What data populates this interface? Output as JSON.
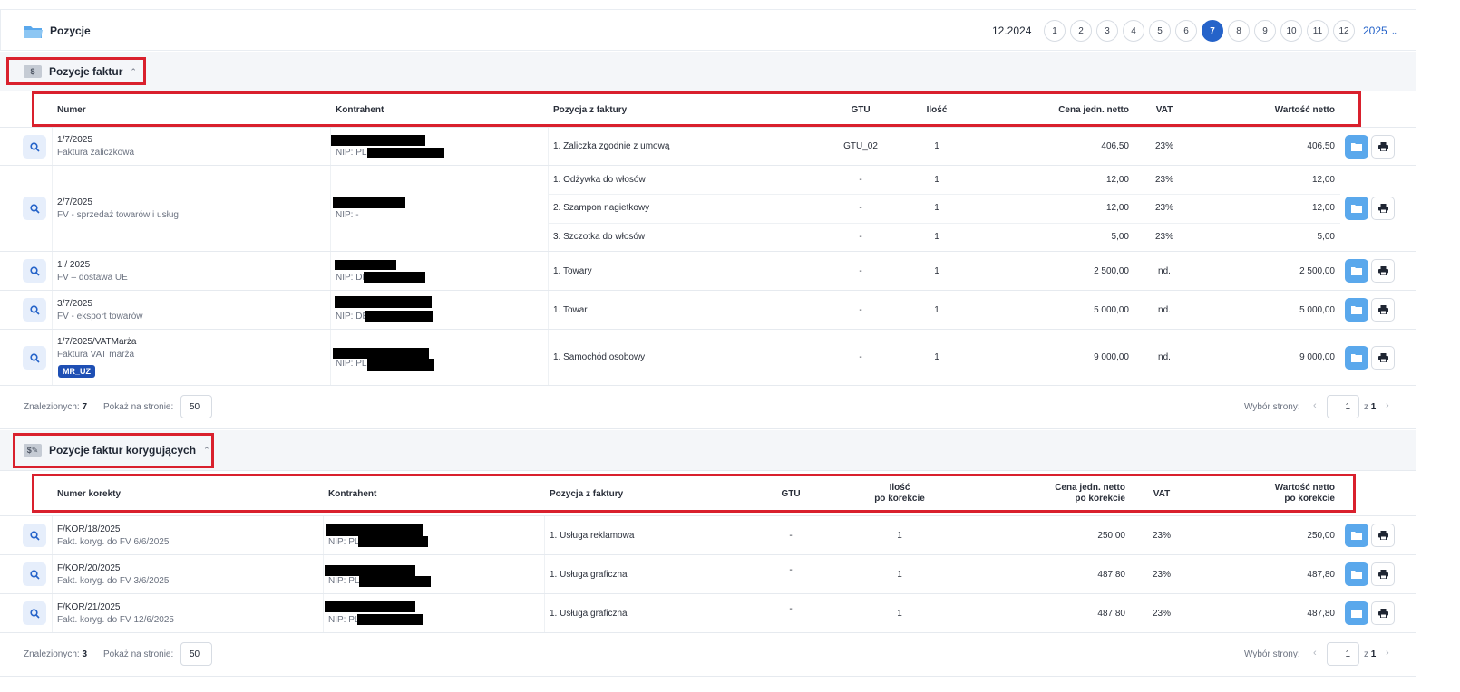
{
  "header": {
    "title": "Pozycje",
    "period": "12.2024",
    "months": [
      "1",
      "2",
      "3",
      "4",
      "5",
      "6",
      "7",
      "8",
      "9",
      "10",
      "11",
      "12"
    ],
    "active_month": "7",
    "year": "2025"
  },
  "invoices": {
    "section_title": "Pozycje faktur",
    "columns": {
      "number": "Numer",
      "contractor": "Kontrahent",
      "item": "Pozycja z faktury",
      "gtu": "GTU",
      "qty": "Ilość",
      "unit_price": "Cena jedn. netto",
      "vat": "VAT",
      "net_value": "Wartość netto"
    },
    "rows": [
      {
        "number": "1/7/2025",
        "type": "Faktura zaliczkowa",
        "nip": "NIP: PL",
        "items": [
          {
            "name": "1. Zaliczka zgodnie z umową",
            "gtu": "GTU_02",
            "qty": "1",
            "price": "406,50",
            "vat": "23%",
            "value": "406,50"
          }
        ]
      },
      {
        "number": "2/7/2025",
        "type": "FV - sprzedaż towarów i usług",
        "nip": "NIP: -",
        "items": [
          {
            "name": "1. Odżywka do włosów",
            "gtu": "-",
            "qty": "1",
            "price": "12,00",
            "vat": "23%",
            "value": "12,00"
          },
          {
            "name": "2. Szampon nagietkowy",
            "gtu": "-",
            "qty": "1",
            "price": "12,00",
            "vat": "23%",
            "value": "12,00"
          },
          {
            "name": "3. Szczotka do włosów",
            "gtu": "-",
            "qty": "1",
            "price": "5,00",
            "vat": "23%",
            "value": "5,00"
          }
        ]
      },
      {
        "number": "1 / 2025",
        "type": "FV – dostawa UE",
        "nip": "NIP: DE",
        "items": [
          {
            "name": "1. Towary",
            "gtu": "-",
            "qty": "1",
            "price": "2 500,00",
            "vat": "nd.",
            "value": "2 500,00"
          }
        ]
      },
      {
        "number": "3/7/2025",
        "type": "FV - eksport towarów",
        "nip": "NIP: DE",
        "items": [
          {
            "name": "1. Towar",
            "gtu": "-",
            "qty": "1",
            "price": "5 000,00",
            "vat": "nd.",
            "value": "5 000,00"
          }
        ]
      },
      {
        "number": "1/7/2025/VATMarża",
        "type": "Faktura VAT marża",
        "nip": "NIP: PL",
        "badge": "MR_UZ",
        "items": [
          {
            "name": "1. Samochód osobowy",
            "gtu": "-",
            "qty": "1",
            "price": "9 000,00",
            "vat": "nd.",
            "value": "9 000,00"
          }
        ]
      }
    ],
    "footer": {
      "found_label": "Znalezionych:",
      "found_count": "7",
      "per_page_label": "Pokaż na stronie:",
      "per_page": "50",
      "page_label": "Wybór strony:",
      "page": "1",
      "of_label": "z",
      "pages": "1"
    }
  },
  "corrections": {
    "section_title": "Pozycje faktur korygujących",
    "columns": {
      "number": "Numer korekty",
      "contractor": "Kontrahent",
      "item": "Pozycja z faktury",
      "gtu": "GTU",
      "qty_1": "Ilość",
      "qty_2": "po korekcie",
      "price_1": "Cena jedn. netto",
      "price_2": "po korekcie",
      "vat": "VAT",
      "value_1": "Wartość netto",
      "value_2": "po korekcie"
    },
    "rows": [
      {
        "number": "F/KOR/18/2025",
        "type": "Fakt. koryg. do FV 6/6/2025",
        "nip": "NIP: PL",
        "item": "1. Usługa reklamowa",
        "gtu": "-",
        "qty": "1",
        "price": "250,00",
        "vat": "23%",
        "value": "250,00"
      },
      {
        "number": "F/KOR/20/2025",
        "type": "Fakt. koryg. do FV 3/6/2025",
        "nip": "NIP: PL",
        "item": "1. Usługa graficzna",
        "gtu": "-",
        "qty": "1",
        "price": "487,80",
        "vat": "23%",
        "value": "487,80"
      },
      {
        "number": "F/KOR/21/2025",
        "type": "Fakt. koryg. do FV 12/6/2025",
        "nip": "NIP: PL",
        "item": "1. Usługa graficzna",
        "gtu": "-",
        "qty": "1",
        "price": "487,80",
        "vat": "23%",
        "value": "487,80"
      }
    ],
    "footer": {
      "found_label": "Znalezionych:",
      "found_count": "3",
      "per_page_label": "Pokaż na stronie:",
      "per_page": "50",
      "page_label": "Wybór strony:",
      "page": "1",
      "of_label": "z",
      "pages": "1"
    }
  },
  "icons": {
    "search": "search-icon",
    "folder": "folder-icon",
    "print": "printer-icon",
    "chev_left": "‹",
    "chev_right": "›",
    "caret": "^"
  },
  "colors": {
    "accent": "#2563c9",
    "folder_btn": "#5aa8ec",
    "badge": "#1e4fb4",
    "highlight": "#d9202d"
  }
}
